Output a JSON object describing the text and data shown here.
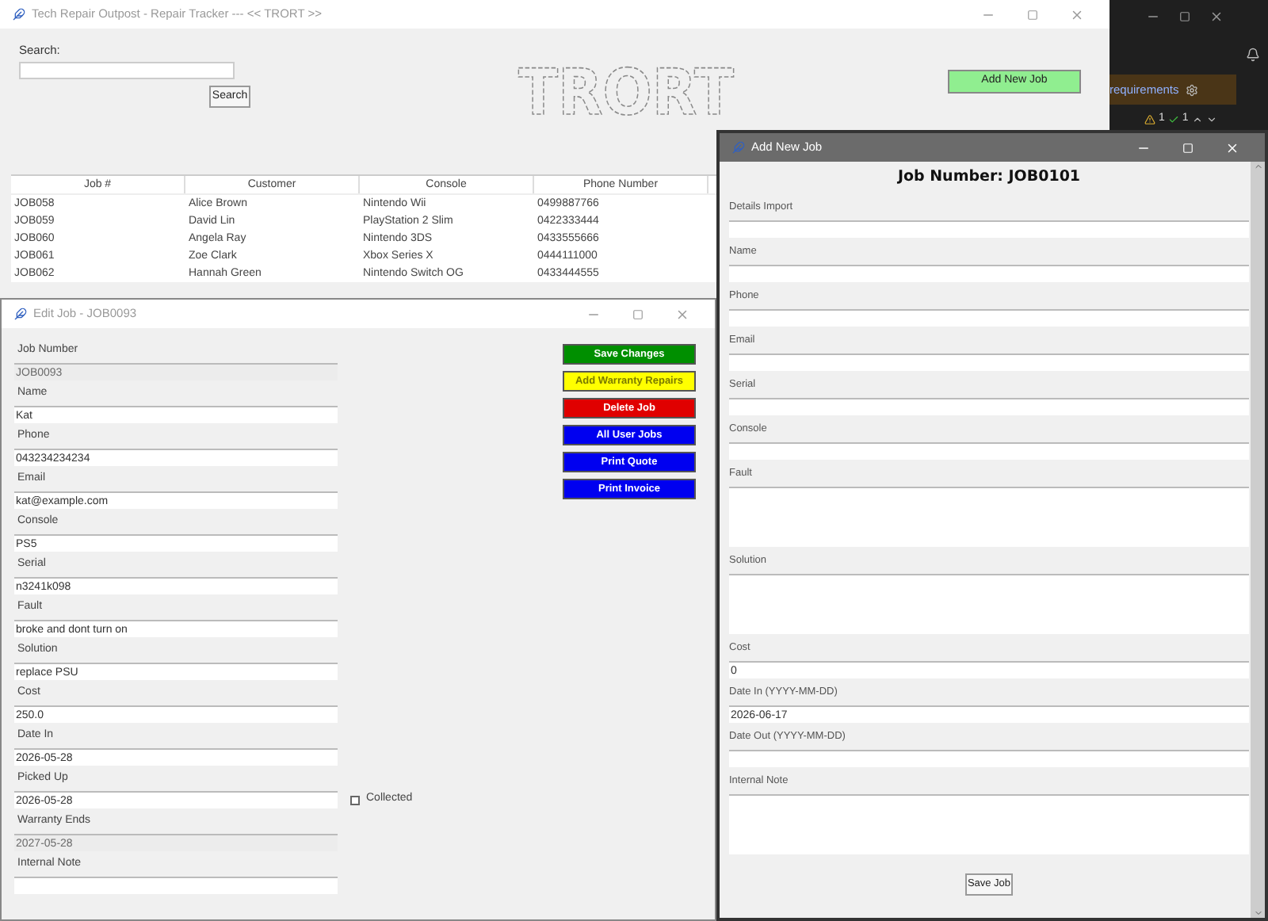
{
  "background_app": {
    "banner": "requirements",
    "warnings": "1",
    "checks": "1"
  },
  "main_window": {
    "title": "Tech Repair Outpost - Repair Tracker --- << TRORT >>",
    "search_label": "Search:",
    "search_button": "Search",
    "add_button": "Add New Job",
    "logo": "TRORT",
    "table": {
      "columns": [
        "Job #",
        "Customer",
        "Console",
        "Phone Number"
      ],
      "rows": [
        [
          "JOB058",
          "Alice Brown",
          "Nintendo Wii",
          "0499887766"
        ],
        [
          "JOB059",
          "David Lin",
          "PlayStation 2 Slim",
          "0422333444"
        ],
        [
          "JOB060",
          "Angela Ray",
          "Nintendo 3DS",
          "0433555666"
        ],
        [
          "JOB061",
          "Zoe Clark",
          "Xbox Series X",
          "0444111000"
        ],
        [
          "JOB062",
          "Hannah Green",
          "Nintendo Switch OG",
          "0433444555"
        ]
      ]
    }
  },
  "edit_window": {
    "title": "Edit Job - JOB0093",
    "fields": [
      {
        "label": "Job Number",
        "value": "JOB0093",
        "disabled": true
      },
      {
        "label": "Name",
        "value": "Kat",
        "disabled": false
      },
      {
        "label": "Phone",
        "value": "043234234234",
        "disabled": false
      },
      {
        "label": "Email",
        "value": "kat@example.com",
        "disabled": false
      },
      {
        "label": "Console",
        "value": "PS5",
        "disabled": false
      },
      {
        "label": "Serial",
        "value": "n3241k098",
        "disabled": false
      },
      {
        "label": "Fault",
        "value": "broke and dont turn on",
        "disabled": false
      },
      {
        "label": "Solution",
        "value": "replace PSU",
        "disabled": false
      },
      {
        "label": "Cost",
        "value": "250.0",
        "disabled": false
      },
      {
        "label": "Date In",
        "value": "2026-05-28",
        "disabled": false
      },
      {
        "label": "Picked Up",
        "value": "2026-05-28",
        "disabled": false,
        "checkbox": {
          "label": "Collected",
          "checked": false
        }
      },
      {
        "label": "Warranty Ends",
        "value": "2027-05-28",
        "disabled": true
      },
      {
        "label": "Internal Note",
        "disabled": false
      }
    ],
    "buttons": [
      {
        "label": "Save Changes",
        "color": "#008f00"
      },
      {
        "label": "Add Warranty Repairs",
        "color": "#ffff00"
      },
      {
        "label": "Delete Job",
        "color": "#e00000"
      },
      {
        "label": "All User Jobs",
        "color": "#0000f0"
      },
      {
        "label": "Print Quote",
        "color": "#0000f0"
      },
      {
        "label": "Print Invoice",
        "color": "#0000f0"
      }
    ]
  },
  "add_window": {
    "title": "Add New Job",
    "heading": "Job Number: JOB0101",
    "fields": [
      {
        "label": "Details Import",
        "kind": "line"
      },
      {
        "label": "Name",
        "kind": "line"
      },
      {
        "label": "Phone",
        "kind": "line"
      },
      {
        "label": "Email",
        "kind": "line"
      },
      {
        "label": "Serial",
        "kind": "line"
      },
      {
        "label": "Console",
        "kind": "line"
      },
      {
        "label": "Fault",
        "kind": "area"
      },
      {
        "label": "Solution",
        "kind": "area"
      },
      {
        "label": "Cost",
        "kind": "line",
        "value": "0"
      },
      {
        "label": "Date In (YYYY-MM-DD)",
        "kind": "line",
        "value": "2026-06-17"
      },
      {
        "label": "Date Out (YYYY-MM-DD)",
        "kind": "line"
      },
      {
        "label": "Internal Note",
        "kind": "area"
      }
    ],
    "save_button": "Save Job"
  }
}
